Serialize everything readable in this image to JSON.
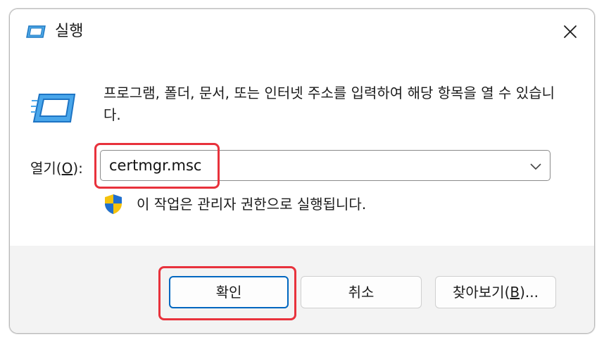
{
  "window": {
    "title": "실행",
    "icon": "run-icon",
    "close_icon": "close-icon"
  },
  "content": {
    "description": "프로그램, 폴더, 문서, 또는 인터넷 주소를 입력하여 해당 항목을 열 수 있습니다.",
    "open_label_prefix": "열기(",
    "open_label_mnemonic": "O",
    "open_label_suffix": "):",
    "command_value": "certmgr.msc",
    "admin_note": "이 작업은 관리자 권한으로 실행됩니다."
  },
  "buttons": {
    "ok": "확인",
    "cancel": "취소",
    "browse_prefix": "찾아보기(",
    "browse_mnemonic": "B",
    "browse_suffix": ")..."
  },
  "colors": {
    "highlight": "#e8323c",
    "accent": "#0067c0",
    "icon_blue": "#1e90d6",
    "shield_blue": "#1f6fd0",
    "shield_yellow": "#f4c20d"
  }
}
